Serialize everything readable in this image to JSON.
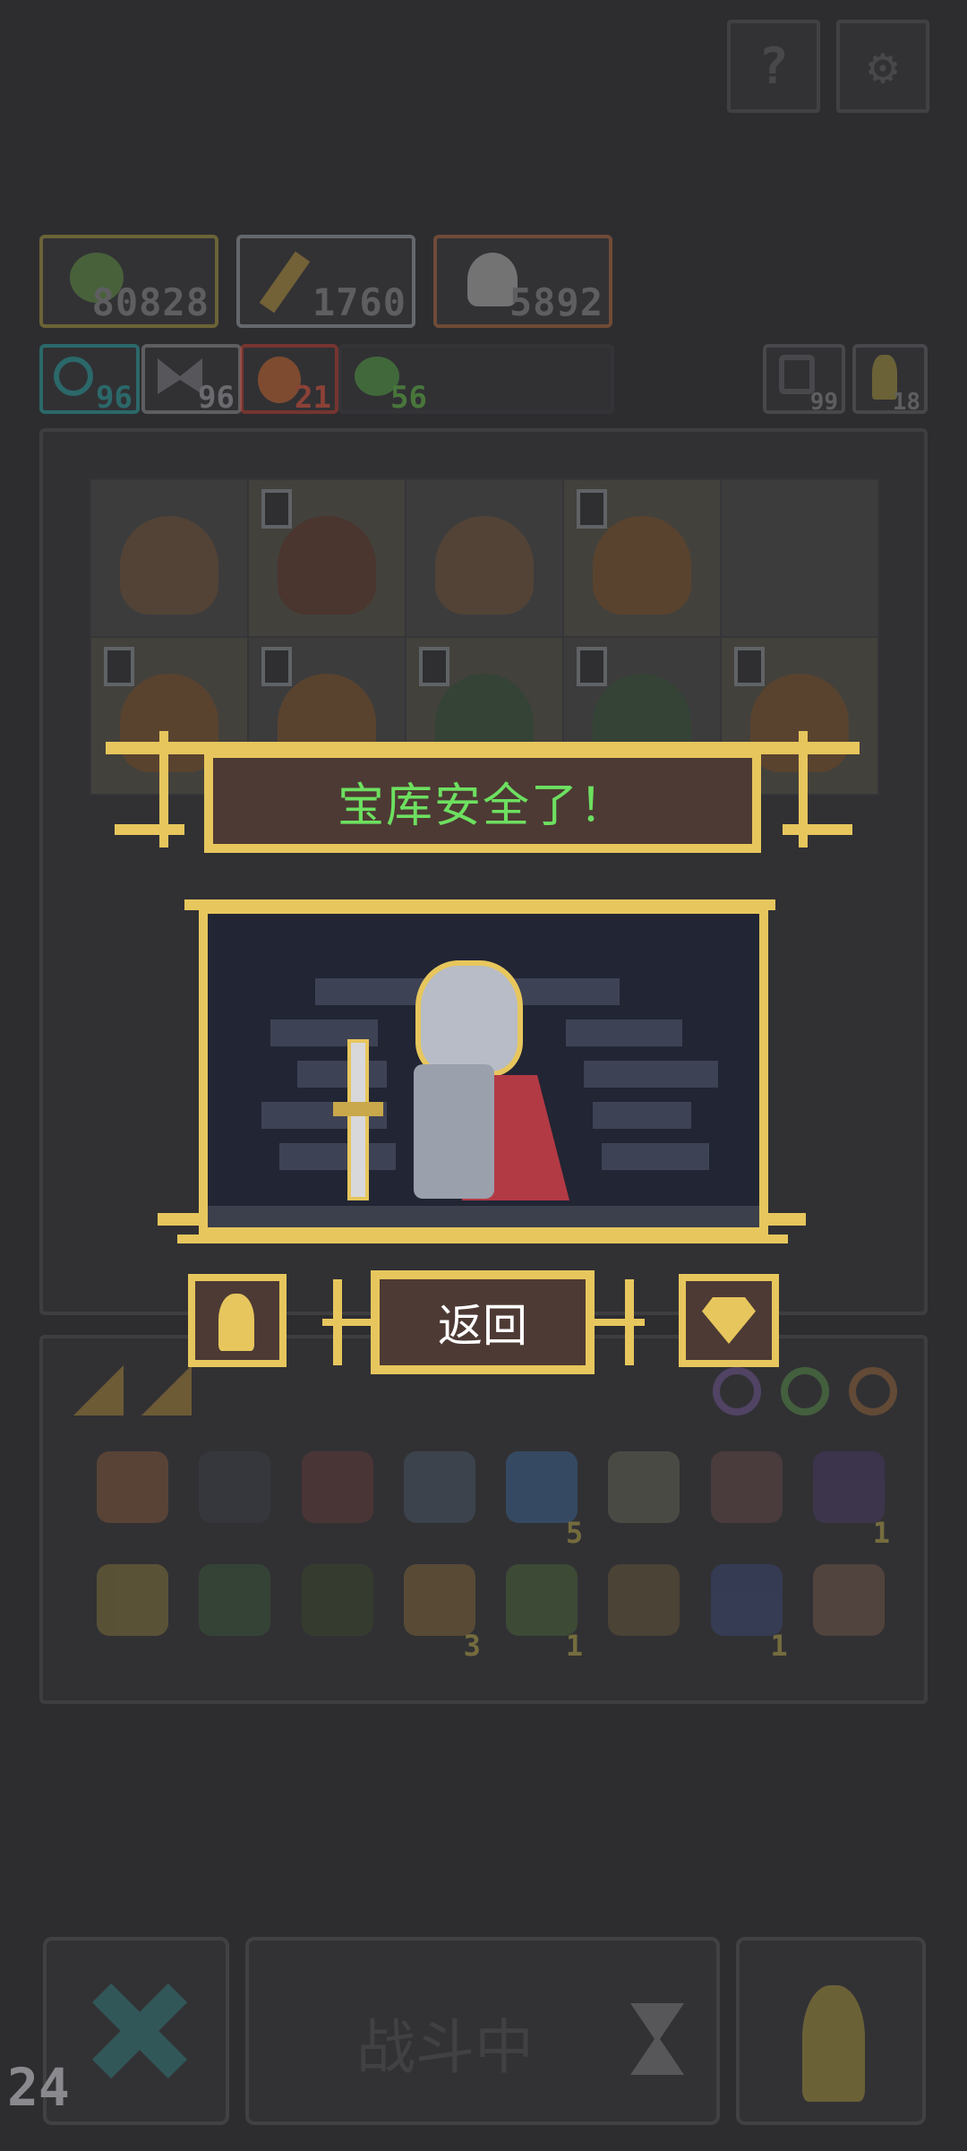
{
  "top_buttons": {
    "help_label": "?",
    "settings_label": "⚙"
  },
  "resources": [
    {
      "name": "seeds",
      "value": "80828",
      "color": "#8e8b3b"
    },
    {
      "name": "staff",
      "value": "1760",
      "color": "#6a6e78"
    },
    {
      "name": "ghost",
      "value": "5892",
      "color": "#8a5a3a"
    }
  ],
  "stats": [
    {
      "name": "swirl",
      "value": "96",
      "color": "#2f8a8a"
    },
    {
      "name": "moth",
      "value": "96",
      "color": "#7a7a80"
    },
    {
      "name": "fire",
      "value": "21",
      "color": "#a83a2a"
    },
    {
      "name": "sprout",
      "value": "56",
      "color": "#4a8a3a"
    }
  ],
  "side_counters": [
    {
      "name": "refresh",
      "value": "99"
    },
    {
      "name": "pawn",
      "value": "18"
    }
  ],
  "grid": {
    "cells": [
      {
        "kind": "creature",
        "level": "",
        "color": "#7a5a3a"
      },
      {
        "kind": "creature",
        "level": "0",
        "color": "#6a3a2a"
      },
      {
        "kind": "creature",
        "level": "",
        "color": "#7a5a3a"
      },
      {
        "kind": "creature",
        "level": "0",
        "color": "#8a5a2a"
      },
      {
        "kind": "empty",
        "level": "",
        "color": ""
      },
      {
        "kind": "creature",
        "level": "0",
        "color": "#8a5a2a"
      },
      {
        "kind": "creature",
        "level": "0",
        "color": "#8a5a2a"
      },
      {
        "kind": "creature",
        "level": "0",
        "color": "#3a5a3a"
      },
      {
        "kind": "creature",
        "level": "0",
        "color": "#3a5a3a"
      },
      {
        "kind": "creature",
        "level": "0",
        "color": "#8a5a2a"
      }
    ]
  },
  "dialog": {
    "title": "宝库安全了！",
    "return_label": "返回"
  },
  "inventory": {
    "row1": [
      {
        "name": "mask",
        "color": "#8a5a3a",
        "count": ""
      },
      {
        "name": "shield",
        "color": "#3a4048",
        "count": ""
      },
      {
        "name": "helmet",
        "color": "#6a3a3a",
        "count": ""
      },
      {
        "name": "whirl",
        "color": "#4a5a6a",
        "count": ""
      },
      {
        "name": "orb",
        "color": "#3a6a9a",
        "count": "5"
      },
      {
        "name": "crown",
        "color": "#6a6a5a",
        "count": ""
      },
      {
        "name": "chest",
        "color": "#6a4a4a",
        "count": ""
      },
      {
        "name": "jar",
        "color": "#4a3a6a",
        "count": "1"
      }
    ],
    "row2": [
      {
        "name": "staff",
        "color": "#8a7a3a",
        "count": ""
      },
      {
        "name": "arrow",
        "color": "#3a5a3a",
        "count": ""
      },
      {
        "name": "pot",
        "color": "#3a4a2a",
        "count": ""
      },
      {
        "name": "ring",
        "color": "#8a6a3a",
        "count": "3"
      },
      {
        "name": "leaf",
        "color": "#4a6a3a",
        "count": "1"
      },
      {
        "name": "cake",
        "color": "#6a5a3a",
        "count": ""
      },
      {
        "name": "hourglass",
        "color": "#3a4a7a",
        "count": "1"
      },
      {
        "name": "hand",
        "color": "#7a5a4a",
        "count": ""
      }
    ]
  },
  "bottom_bar": {
    "battle_label": "战斗中",
    "fps": "24"
  }
}
